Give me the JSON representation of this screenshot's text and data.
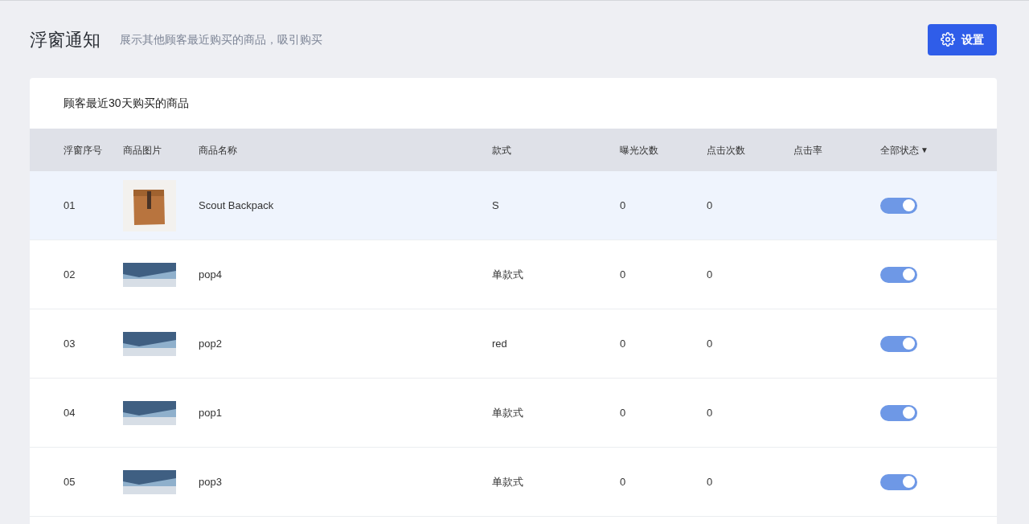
{
  "header": {
    "title": "浮窗通知",
    "subtitle": "展示其他顾客最近购买的商品，吸引购买",
    "settings_button": "设置"
  },
  "card": {
    "title": "顾客最近30天购买的商品"
  },
  "table": {
    "columns": [
      "浮窗序号",
      "商品图片",
      "商品名称",
      "款式",
      "曝光次数",
      "点击次数",
      "点击率",
      "全部状态"
    ],
    "status_filter_caret": "▼",
    "rows": [
      {
        "index": "01",
        "image": {
          "kind": "product"
        },
        "name": "Scout Backpack",
        "variant": "S",
        "impressions": "0",
        "clicks": "0",
        "selected": true,
        "on": true
      },
      {
        "index": "02",
        "image": {
          "kind": "scene"
        },
        "name": "pop4",
        "variant": "单款式",
        "impressions": "0",
        "clicks": "0",
        "selected": false,
        "on": true
      },
      {
        "index": "03",
        "image": {
          "kind": "scene"
        },
        "name": "pop2",
        "variant": "red",
        "impressions": "0",
        "clicks": "0",
        "selected": false,
        "on": true
      },
      {
        "index": "04",
        "image": {
          "kind": "scene"
        },
        "name": "pop1",
        "variant": "单款式",
        "impressions": "0",
        "clicks": "0",
        "selected": false,
        "on": true
      },
      {
        "index": "05",
        "image": {
          "kind": "scene"
        },
        "name": "pop3",
        "variant": "单款式",
        "impressions": "0",
        "clicks": "0",
        "selected": false,
        "on": true
      }
    ]
  }
}
